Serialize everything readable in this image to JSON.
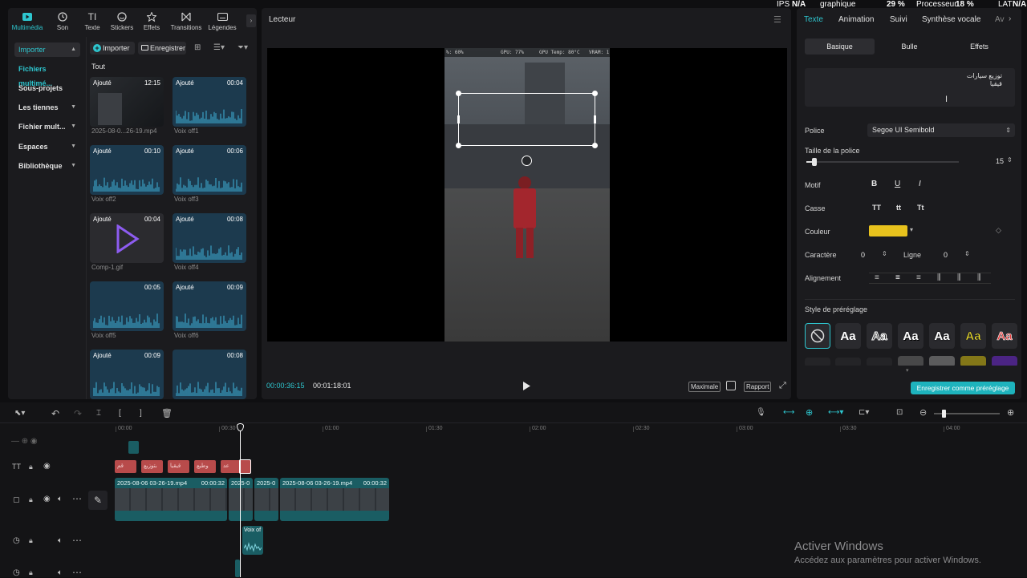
{
  "overlay": {
    "ips_label": "IPS",
    "ips_value": "N/A",
    "graphique": "graphique",
    "gpu_pct": "29 %",
    "processeur_label": "Processeur",
    "processeur_value": "18 %",
    "lat_label": "LAT",
    "lat_value": "N/A"
  },
  "left": {
    "tabs": [
      {
        "label": "Multimédia",
        "icon": "media-icon"
      },
      {
        "label": "Son",
        "icon": "music-icon"
      },
      {
        "label": "Texte",
        "icon": "text-icon"
      },
      {
        "label": "Stickers",
        "icon": "sticker-icon"
      },
      {
        "label": "Effets",
        "icon": "effects-icon"
      },
      {
        "label": "Transitions",
        "icon": "transition-icon"
      },
      {
        "label": "Légendes",
        "icon": "captions-icon"
      }
    ],
    "sidebar": [
      {
        "label": "Importer",
        "chev": "▲"
      },
      {
        "label": "Fichiers multimé...",
        "chev": ""
      },
      {
        "label": "Sous-projets",
        "chev": ""
      },
      {
        "label": "Les tiennes",
        "chev": "▼"
      },
      {
        "label": "Fichier mult...",
        "chev": "▼"
      },
      {
        "label": "Espaces",
        "chev": "▼"
      },
      {
        "label": "Bibliothèque",
        "chev": "▼"
      }
    ],
    "toolbar": {
      "import": "Importer",
      "record": "Enregistrer"
    },
    "filter_all": "Tout",
    "media": [
      {
        "tag": "Ajouté",
        "dur": "12:15",
        "name": "2025-08-0...26-19.mp4",
        "kind": "video"
      },
      {
        "tag": "Ajouté",
        "dur": "00:04",
        "name": "Voix off1",
        "kind": "audio"
      },
      {
        "tag": "Ajouté",
        "dur": "00:10",
        "name": "Voix off2",
        "kind": "audio"
      },
      {
        "tag": "Ajouté",
        "dur": "00:06",
        "name": "Voix off3",
        "kind": "audio"
      },
      {
        "tag": "Ajouté",
        "dur": "00:04",
        "name": "Comp-1.gif",
        "kind": "gif"
      },
      {
        "tag": "Ajouté",
        "dur": "00:08",
        "name": "Voix off4",
        "kind": "audio"
      },
      {
        "tag": "",
        "dur": "00:05",
        "name": "Voix off5",
        "kind": "audio"
      },
      {
        "tag": "Ajouté",
        "dur": "00:09",
        "name": "Voix off6",
        "kind": "audio"
      },
      {
        "tag": "Ajouté",
        "dur": "00:09",
        "name": "",
        "kind": "audio"
      },
      {
        "tag": "",
        "dur": "00:08",
        "name": "",
        "kind": "audio"
      }
    ]
  },
  "player": {
    "title": "Lecteur",
    "hud": {
      "a": "%: 60%",
      "b": "GPU: 77%",
      "c": "GPU Temp: 80°C",
      "d": "VRAM: 1"
    },
    "time_current": "00:00:36:15",
    "time_total": "00:01:18:01",
    "quality": "Maximale",
    "ratio": "Rapport"
  },
  "right": {
    "tabs": [
      "Texte",
      "Animation",
      "Suivi",
      "Synthèse vocale",
      "Av"
    ],
    "subtabs": [
      "Basique",
      "Bulle",
      "Effets"
    ],
    "text_line1": "توزيع سيارات",
    "text_line2": "قيقيا",
    "font_label": "Police",
    "font_value": "Segoe UI Semibold",
    "size_label": "Taille de la police",
    "size_value": "15",
    "size_level": 0.05,
    "pattern_label": "Motif",
    "pattern_buttons": [
      "B",
      "U",
      "I"
    ],
    "case_label": "Casse",
    "case_buttons": [
      "TT",
      "tt",
      "Tt"
    ],
    "color_label": "Couleur",
    "color_value": "#e8c21d",
    "char_label": "Caractère",
    "char_value": "0",
    "line_label": "Ligne",
    "line_value": "0",
    "align_label": "Alignement",
    "preset_label": "Style de préréglage",
    "preset_glyph": "Aa",
    "save_preset": "Enregistrer comme préréglage"
  },
  "timeline": {
    "ruler": [
      "00:00",
      "00:30",
      "01:00",
      "01:30",
      "02:00",
      "02:30",
      "03:00",
      "03:30",
      "04:00"
    ],
    "text_clips": [
      "قم",
      "بتوزيع",
      "قيقيا",
      "وطيع",
      "عد"
    ],
    "video_clips": [
      {
        "name": "2025-08-06 03-26-19.mp4",
        "dur": "00:00:32"
      },
      {
        "name": "2025-0",
        "dur": ""
      },
      {
        "name": "2025-0",
        "dur": ""
      },
      {
        "name": "2025-08-06 03-26-19.mp4",
        "dur": "00:00:32"
      }
    ],
    "audio_clip": "Voix of"
  },
  "watermark": {
    "title": "Activer Windows",
    "subtitle": "Accédez aux paramètres pour activer Windows."
  },
  "colors": {
    "accent": "#2ec6cf",
    "text_clip": "#b84b4b",
    "video_clip": "#1a5d63"
  }
}
